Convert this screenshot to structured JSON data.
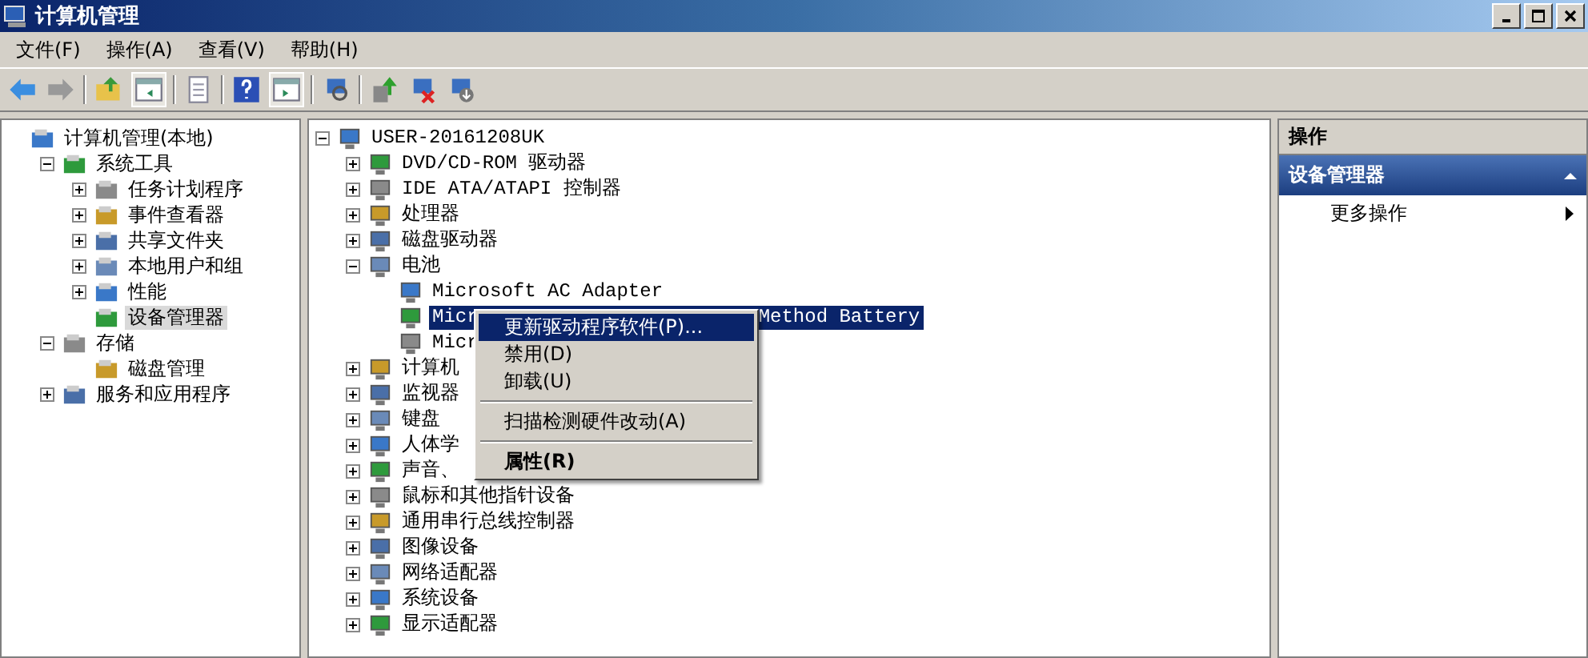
{
  "window": {
    "title": "计算机管理"
  },
  "menu_bar": [
    "文件(F)",
    "操作(A)",
    "查看(V)",
    "帮助(H)"
  ],
  "nav_tree": [
    {
      "label": "计算机管理(本地)",
      "selected": false,
      "children": [
        {
          "label": "系统工具",
          "expanded": true,
          "selected": false,
          "children": [
            {
              "label": "任务计划程序",
              "expanded": false,
              "selected": false
            },
            {
              "label": "事件查看器",
              "expanded": false,
              "selected": false
            },
            {
              "label": "共享文件夹",
              "expanded": false,
              "selected": false
            },
            {
              "label": "本地用户和组",
              "expanded": false,
              "selected": false
            },
            {
              "label": "性能",
              "expanded": false,
              "selected": false
            },
            {
              "label": "设备管理器",
              "selected": true
            }
          ]
        },
        {
          "label": "存储",
          "expanded": true,
          "selected": false,
          "children": [
            {
              "label": "磁盘管理",
              "selected": false
            }
          ]
        },
        {
          "label": "服务和应用程序",
          "expanded": false,
          "selected": false
        }
      ]
    }
  ],
  "device_tree": [
    {
      "label": "USER-20161208UK",
      "expanded": true,
      "selected": false,
      "children": [
        {
          "label": "DVD/CD-ROM 驱动器",
          "expanded": false,
          "selected": false
        },
        {
          "label": "IDE ATA/ATAPI 控制器",
          "expanded": false,
          "selected": false
        },
        {
          "label": "处理器",
          "expanded": false,
          "selected": false
        },
        {
          "label": "磁盘驱动器",
          "expanded": false,
          "selected": false
        },
        {
          "label": "电池",
          "expanded": true,
          "selected": false,
          "children": [
            {
              "label": "Microsoft AC Adapter",
              "selected": false
            },
            {
              "label": "Micr",
              "label_tail": "Method Battery",
              "selected": true
            },
            {
              "label": "Micr",
              "selected": false
            }
          ]
        },
        {
          "label": "计算机",
          "expanded": false,
          "selected": false
        },
        {
          "label": "监视器",
          "expanded": false,
          "selected": false
        },
        {
          "label": "键盘",
          "expanded": false,
          "selected": false
        },
        {
          "label": "人体学",
          "expanded": false,
          "selected": false
        },
        {
          "label": "声音、",
          "expanded": false,
          "selected": false
        },
        {
          "label": "鼠标和其他指针设备",
          "expanded": false,
          "selected": false
        },
        {
          "label": "通用串行总线控制器",
          "expanded": false,
          "selected": false
        },
        {
          "label": "图像设备",
          "expanded": false,
          "selected": false
        },
        {
          "label": "网络适配器",
          "expanded": false,
          "selected": false
        },
        {
          "label": "系统设备",
          "expanded": false,
          "selected": false
        },
        {
          "label": "显示适配器",
          "expanded": false,
          "selected": false
        }
      ]
    }
  ],
  "context_menu": {
    "items": [
      {
        "kind": "item",
        "label": "更新驱动程序软件(P)...",
        "selected": true,
        "default": false
      },
      {
        "kind": "item",
        "label": "禁用(D)",
        "selected": false,
        "default": false
      },
      {
        "kind": "item",
        "label": "卸载(U)",
        "selected": false,
        "default": false
      },
      {
        "kind": "separator"
      },
      {
        "kind": "item",
        "label": "扫描检测硬件改动(A)",
        "selected": false,
        "default": false
      },
      {
        "kind": "separator"
      },
      {
        "kind": "item",
        "label": "属性(R)",
        "selected": false,
        "default": true
      }
    ]
  },
  "actions_pane": {
    "title": "操作",
    "section": {
      "label": "设备管理器",
      "expanded": true
    },
    "items": [
      "更多操作"
    ]
  }
}
